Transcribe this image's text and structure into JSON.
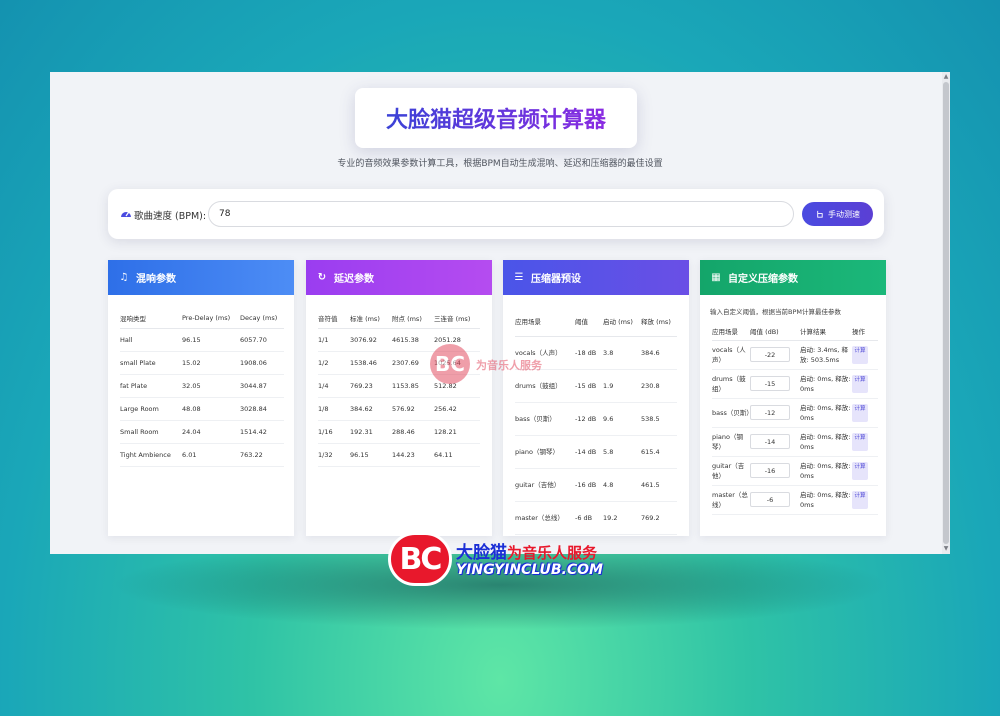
{
  "header": {
    "title": "大脸猫超级音频计算器",
    "subtitle": "专业的音频效果参数计算工具，根据BPM自动生成混响、延迟和压缩器的最佳设置"
  },
  "bpm": {
    "label": "歌曲速度 (BPM):",
    "value": "78",
    "tap_button": "手动测速"
  },
  "reverb": {
    "title": "混响参数",
    "columns": [
      "混响类型",
      "Pre-Delay (ms)",
      "Decay (ms)"
    ],
    "rows": [
      [
        "Hall",
        "96.15",
        "6057.70"
      ],
      [
        "small Plate",
        "15.02",
        "1908.06"
      ],
      [
        "fat Plate",
        "32.05",
        "3044.87"
      ],
      [
        "Large Room",
        "48.08",
        "3028.84"
      ],
      [
        "Small Room",
        "24.04",
        "1514.42"
      ],
      [
        "Tight Ambience",
        "6.01",
        "763.22"
      ]
    ]
  },
  "delay": {
    "title": "延迟参数",
    "columns": [
      "音符值",
      "标准 (ms)",
      "附点 (ms)",
      "三连音 (ms)"
    ],
    "rows": [
      [
        "1/1",
        "3076.92",
        "4615.38",
        "2051.28"
      ],
      [
        "1/2",
        "1538.46",
        "2307.69",
        "1025.64"
      ],
      [
        "1/4",
        "769.23",
        "1153.85",
        "512.82"
      ],
      [
        "1/8",
        "384.62",
        "576.92",
        "256.42"
      ],
      [
        "1/16",
        "192.31",
        "288.46",
        "128.21"
      ],
      [
        "1/32",
        "96.15",
        "144.23",
        "64.11"
      ]
    ]
  },
  "compressor": {
    "title": "压缩器预设",
    "columns": [
      "应用场景",
      "阈值",
      "启动 (ms)",
      "释放 (ms)"
    ],
    "rows": [
      [
        "vocals（人声）",
        "-18 dB",
        "3.8",
        "384.6"
      ],
      [
        "drums（鼓组）",
        "-15 dB",
        "1.9",
        "230.8"
      ],
      [
        "bass（贝斯）",
        "-12 dB",
        "9.6",
        "538.5"
      ],
      [
        "piano（钢琴）",
        "-14 dB",
        "5.8",
        "615.4"
      ],
      [
        "guitar（吉他）",
        "-16 dB",
        "4.8",
        "461.5"
      ],
      [
        "master（总线）",
        "-6 dB",
        "19.2",
        "769.2"
      ]
    ]
  },
  "custom": {
    "title": "自定义压缩参数",
    "description": "输入自定义阈值，根据当前BPM计算最佳参数",
    "columns": [
      "应用场景",
      "阈值 (dB)",
      "计算结果",
      "操作"
    ],
    "calc_label": "计算",
    "rows": [
      {
        "scene": "vocals（人声）",
        "threshold": "-22",
        "result": "启动: 3.4ms, 释放: 503.5ms"
      },
      {
        "scene": "drums（鼓组）",
        "threshold": "-15",
        "result": "启动: 0ms, 释放: 0ms"
      },
      {
        "scene": "bass（贝斯）",
        "threshold": "-12",
        "result": "启动: 0ms, 释放: 0ms"
      },
      {
        "scene": "piano（钢琴）",
        "threshold": "-14",
        "result": "启动: 0ms, 释放: 0ms"
      },
      {
        "scene": "guitar（吉他）",
        "threshold": "-16",
        "result": "启动: 0ms, 释放: 0ms"
      },
      {
        "scene": "master（总线）",
        "threshold": "-6",
        "result": "启动: 0ms, 释放: 0ms"
      }
    ]
  },
  "watermark": {
    "center_mark": "BC",
    "center_text": "为音乐人服务",
    "logo_mark": "BC",
    "logo_name": "大脸猫",
    "logo_slogan": "为音乐人服务",
    "logo_url": "YINGYINCLUB.COM"
  },
  "colors": {
    "reverb_header": "#2e6fe8",
    "delay_header": "#9a3df0",
    "compressor_header": "#4a55e8",
    "custom_header": "#14a56a",
    "accent": "#4a4be0",
    "brand_red": "#e8182c"
  },
  "icons": {
    "bpm": "gauge-icon",
    "tap": "hand-pointer-icon",
    "reverb": "music-note-icon",
    "delay": "redo-icon",
    "compressor": "sliders-icon",
    "custom": "calculator-icon"
  }
}
